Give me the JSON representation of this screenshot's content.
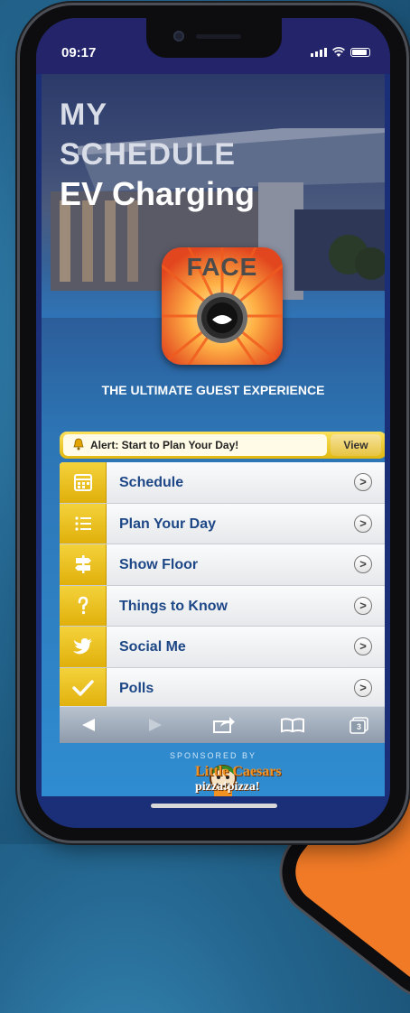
{
  "status_bar": {
    "time": "09:17"
  },
  "hero": {
    "title_line1": "MY",
    "title_line2": "SCHEDULE",
    "title_line3": "EV Charging",
    "logo_text": "FACE",
    "tagline": "THE ULTIMATE GUEST EXPERIENCE"
  },
  "alert": {
    "text": "Alert: Start to Plan Your Day!",
    "button": "View"
  },
  "menu": {
    "items": [
      {
        "label": "Schedule",
        "icon": "calendar-icon"
      },
      {
        "label": "Plan Your Day",
        "icon": "list-icon"
      },
      {
        "label": "Show Floor",
        "icon": "signpost-icon"
      },
      {
        "label": "Things to Know",
        "icon": "question-icon"
      },
      {
        "label": "Social Me",
        "icon": "bird-icon"
      },
      {
        "label": "Polls",
        "icon": "checkmark-icon"
      }
    ],
    "chevron": ">"
  },
  "toolbar": {
    "tabs_count": "3"
  },
  "sponsor": {
    "label": "SPONSORED BY",
    "brand": "Little Caesars",
    "slogan": "pizza!pizza!"
  },
  "colors": {
    "accent_yellow": "#e8bc12",
    "menu_text": "#1d4786",
    "status_bar": "#23246a"
  }
}
